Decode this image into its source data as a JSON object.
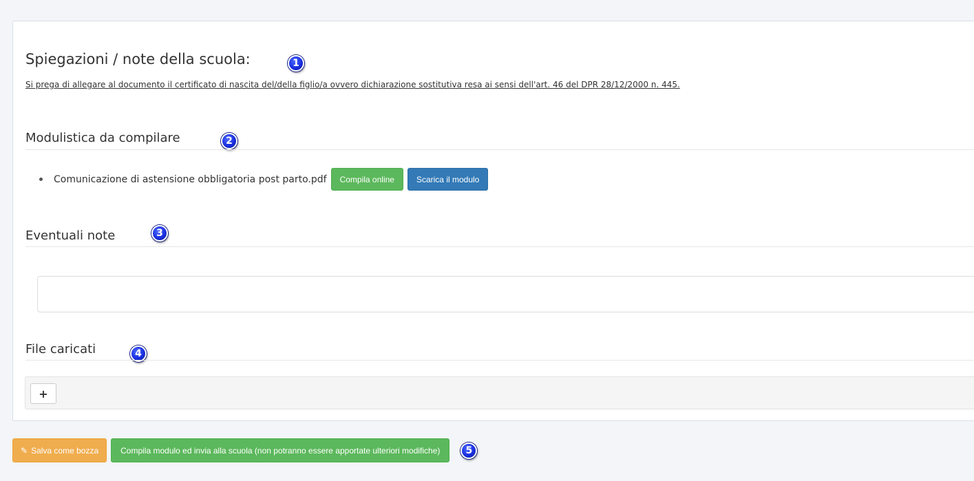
{
  "school_notes": {
    "title": "Spiegazioni / note della scuola:",
    "text": "Si prega di allegare al documento il certificato di nascita del/della figlio/a ovvero dichiarazione sostitutiva resa ai sensi dell'art. 46 del DPR 28/12/2000 n. 445."
  },
  "forms": {
    "heading": "Modulistica da compilare",
    "items": [
      {
        "filename": "Comunicazione di astensione obbligatoria post parto.pdf",
        "fill_online_label": "Compila online",
        "download_label": "Scarica il modulo"
      }
    ]
  },
  "notes": {
    "heading": "Eventuali note",
    "value": ""
  },
  "uploads": {
    "heading": "File caricati",
    "add_label": "+"
  },
  "footer": {
    "save_draft_label": "Salva come bozza",
    "submit_label": "Compila modulo ed invia alla scuola (non potranno essere apportate ulteriori modifiche)"
  },
  "markers": [
    "1",
    "2",
    "3",
    "4",
    "5"
  ],
  "colors": {
    "success": "#5cb85c",
    "primary": "#337ab7",
    "warning": "#f0ad4e",
    "marker": "#1a2fe0"
  },
  "icons": {
    "save_draft": "edit-icon",
    "add_file": "plus-icon"
  }
}
